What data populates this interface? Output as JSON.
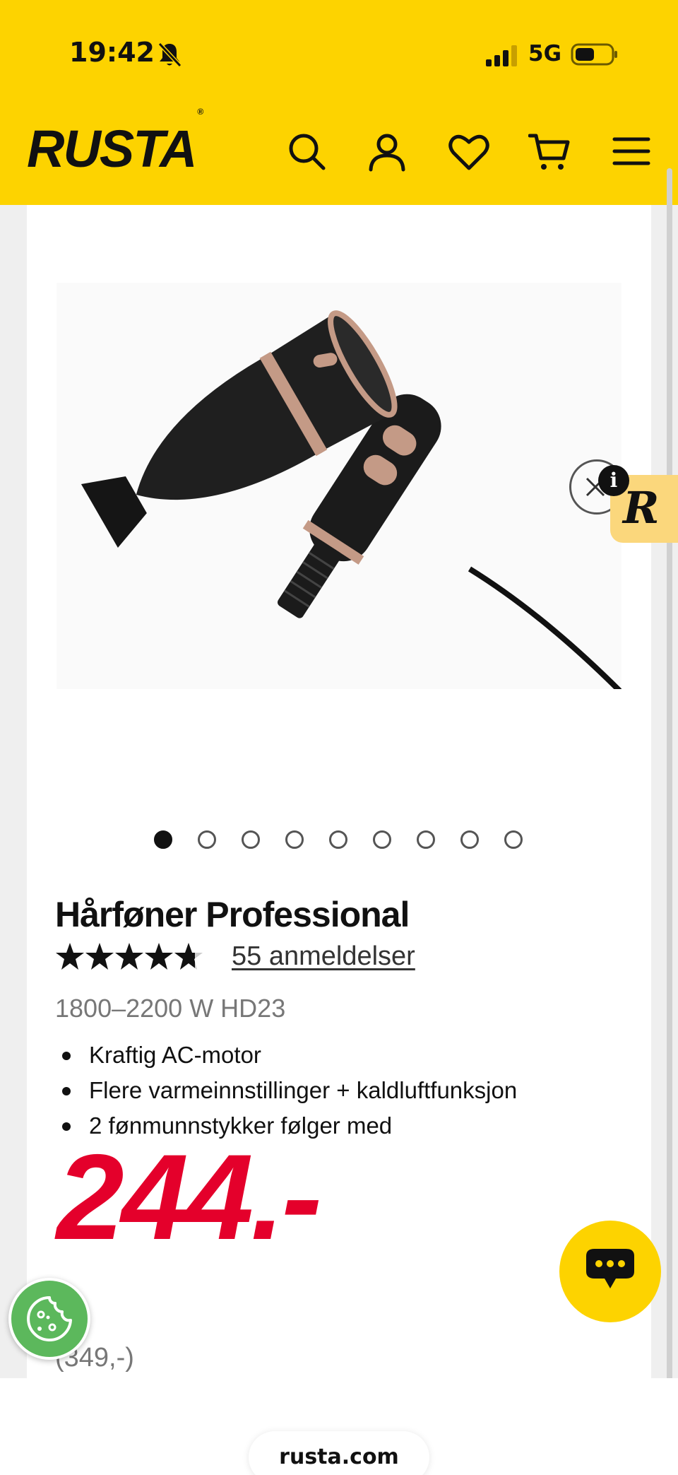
{
  "status_bar": {
    "time": "19:42",
    "network": "5G"
  },
  "header": {
    "logo": "RUSTA",
    "logo_mark": "®",
    "icons": [
      "search-icon",
      "account-icon",
      "heart-icon",
      "cart-icon",
      "menu-icon"
    ]
  },
  "gallery": {
    "image_count": 9,
    "active_index": 0
  },
  "product": {
    "title": "Hårføner Professional",
    "rating": 4.6,
    "rating_max": 5,
    "reviews": "55 anmeldelser",
    "variant": "1800–2200 W HD23",
    "bullets": [
      "Kraftig AC-motor",
      "Flere varmeinnstillinger + kaldluftfunksjon",
      "2 fønmunnstykker følger med"
    ],
    "price": "244.-",
    "old_price": "(349,-)"
  },
  "promo": {
    "badge_letter": "R",
    "info_letter": "i"
  },
  "browser": {
    "url": "rusta.com"
  },
  "colors": {
    "brand_yellow": "#fdd300",
    "price_red": "#e4002b",
    "cookie_green": "#5cb85c"
  }
}
